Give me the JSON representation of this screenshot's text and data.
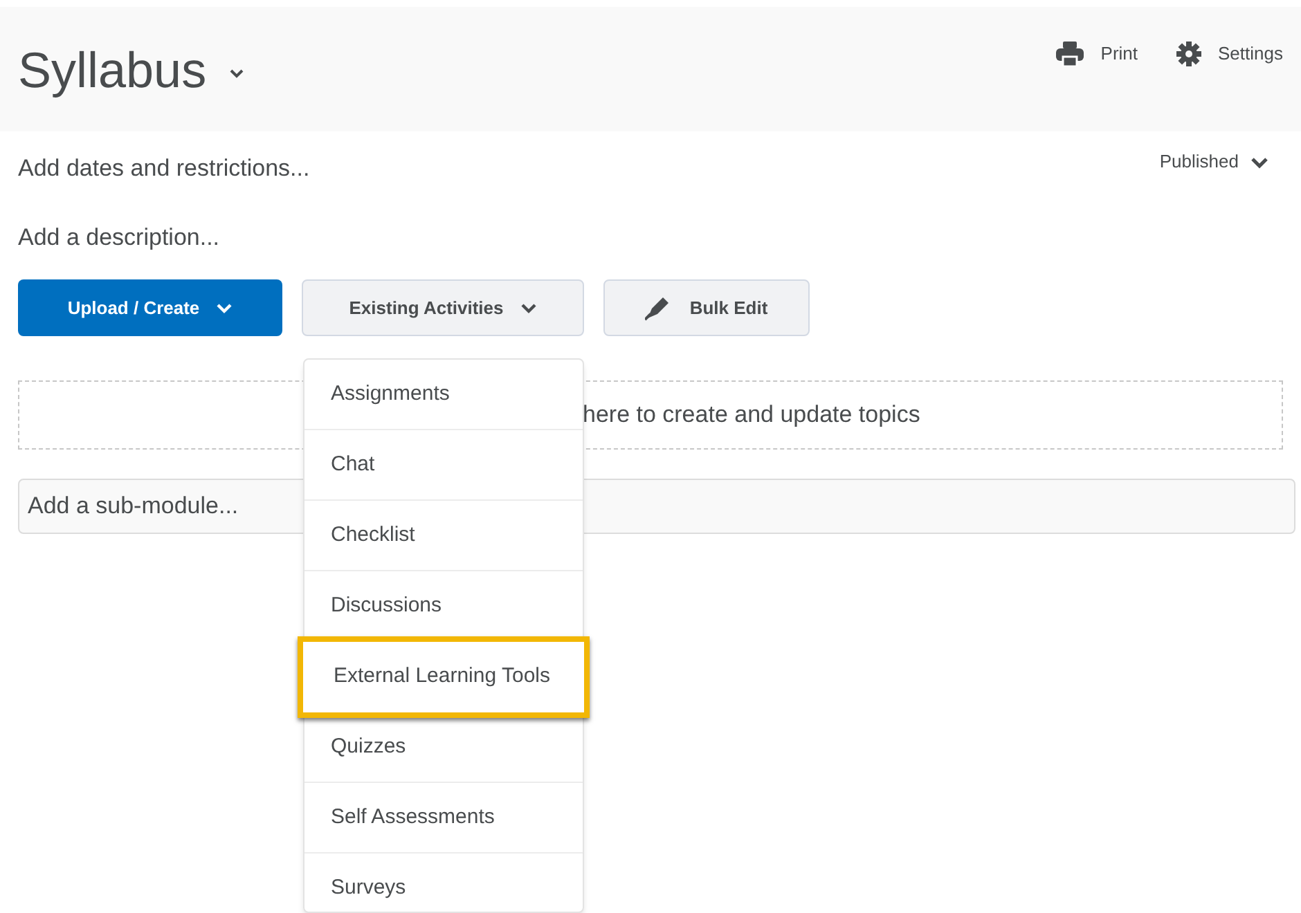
{
  "header": {
    "title": "Syllabus",
    "actions": [
      {
        "kind": "print",
        "label": "Print"
      },
      {
        "kind": "settings",
        "label": "Settings"
      }
    ]
  },
  "status": {
    "label": "Published"
  },
  "links": [
    "Add dates and restrictions...",
    "Add a description..."
  ],
  "buttons": [
    {
      "label": "Upload / Create",
      "kind": "primary"
    },
    {
      "label": "Existing Activities",
      "kind": "dropdown"
    },
    {
      "label": "Bulk Edit",
      "kind": "bulk"
    }
  ],
  "dropzone": {
    "text": "here to create and update topics"
  },
  "submodule": {
    "placeholder": "Add a sub-module..."
  },
  "menu": {
    "items": [
      {
        "label": "Assignments",
        "highlighted": false
      },
      {
        "label": "Chat",
        "highlighted": false
      },
      {
        "label": "Checklist",
        "highlighted": false
      },
      {
        "label": "Discussions",
        "highlighted": false
      },
      {
        "label": "External Learning Tools",
        "highlighted": true
      },
      {
        "label": "Quizzes",
        "highlighted": false
      },
      {
        "label": "Self Assessments",
        "highlighted": false
      },
      {
        "label": "Surveys",
        "highlighted": false
      }
    ]
  }
}
